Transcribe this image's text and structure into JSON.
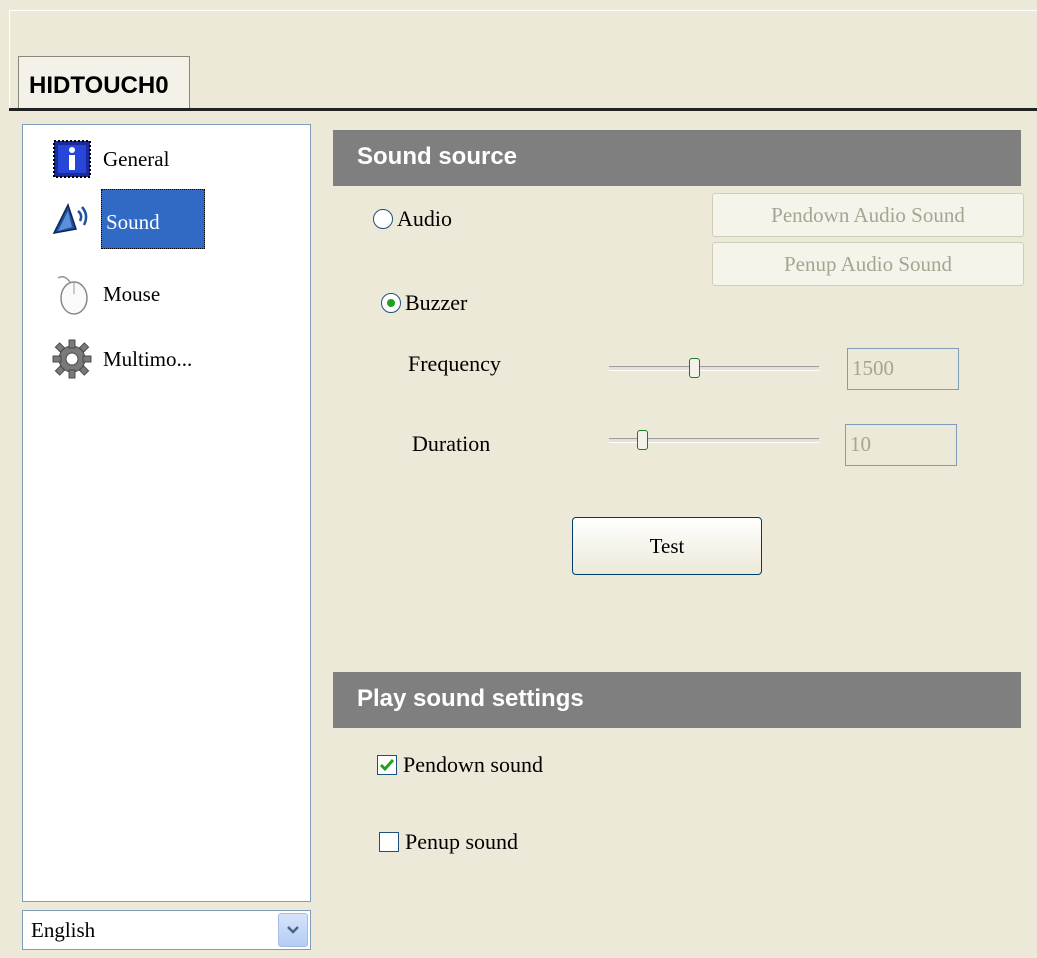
{
  "device_tab": "HIDTOUCH0",
  "sidebar": {
    "items": [
      {
        "label": "General",
        "icon": "info-icon"
      },
      {
        "label": "Sound",
        "icon": "speaker-icon"
      },
      {
        "label": "Mouse",
        "icon": "mouse-icon"
      },
      {
        "label": "Multimo...",
        "icon": "gear-icon"
      }
    ],
    "selected": "Sound"
  },
  "language": {
    "value": "English"
  },
  "sound_source": {
    "title": "Sound source",
    "audio_label": "Audio",
    "pendown_audio_label": "Pendown Audio Sound",
    "penup_audio_label": "Penup Audio Sound",
    "buzzer_label": "Buzzer",
    "selected": "Buzzer",
    "frequency": {
      "label": "Frequency",
      "value": "1500",
      "slider_fraction": 0.4
    },
    "duration": {
      "label": "Duration",
      "value": "10",
      "slider_fraction": 0.14
    },
    "test_label": "Test"
  },
  "play_sound": {
    "title": "Play sound settings",
    "pendown_label": "Pendown sound",
    "pendown_checked": true,
    "penup_label": "Penup sound",
    "penup_checked": false
  }
}
